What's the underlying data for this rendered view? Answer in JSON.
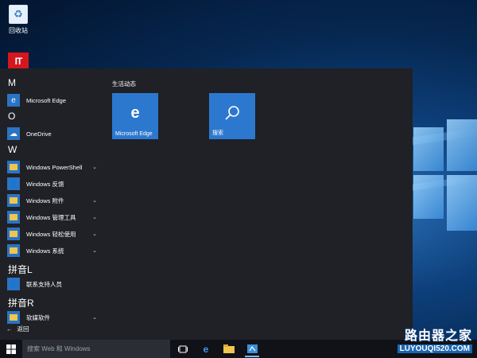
{
  "desktop": {
    "recycle_bin_label": "回收站",
    "logo_text": "IT"
  },
  "start_menu": {
    "groups": [
      {
        "letter": "M",
        "items": [
          {
            "label": "Microsoft Edge",
            "icon": "edge-icon",
            "expandable": false
          }
        ]
      },
      {
        "letter": "O",
        "items": [
          {
            "label": "OneDrive",
            "icon": "onedrive-icon",
            "expandable": false
          }
        ]
      },
      {
        "letter": "W",
        "items": [
          {
            "label": "Windows PowerShell",
            "icon": "folder-icon",
            "expandable": true
          },
          {
            "label": "Windows 反馈",
            "icon": "feedback-icon",
            "expandable": false
          },
          {
            "label": "Windows 附件",
            "icon": "folder-icon",
            "expandable": true
          },
          {
            "label": "Windows 管理工具",
            "icon": "folder-icon",
            "expandable": true
          },
          {
            "label": "Windows 轻松使用",
            "icon": "folder-icon",
            "expandable": true
          },
          {
            "label": "Windows 系统",
            "icon": "folder-icon",
            "expandable": true
          }
        ]
      },
      {
        "letter": "拼音L",
        "items": [
          {
            "label": "联系支持人员",
            "icon": "contact-support-icon",
            "expandable": false
          }
        ]
      },
      {
        "letter": "拼音R",
        "items": [
          {
            "label": "软媒软件",
            "icon": "folder-icon",
            "expandable": true
          }
        ]
      }
    ],
    "back_label": "返回",
    "tiles_group_title": "生活动态",
    "tiles": [
      {
        "label": "Microsoft Edge",
        "icon": "edge-icon"
      },
      {
        "label": "搜索",
        "icon": "search-icon"
      }
    ]
  },
  "taskbar": {
    "search_placeholder": "搜索 Web 和 Windows"
  },
  "watermark": {
    "line1": "路由器之家",
    "line2": "LUYOUQI520.COM"
  },
  "colors": {
    "accent": "#2c78cf",
    "menu_bg": "#1f2126",
    "taskbar_bg": "#101217"
  }
}
